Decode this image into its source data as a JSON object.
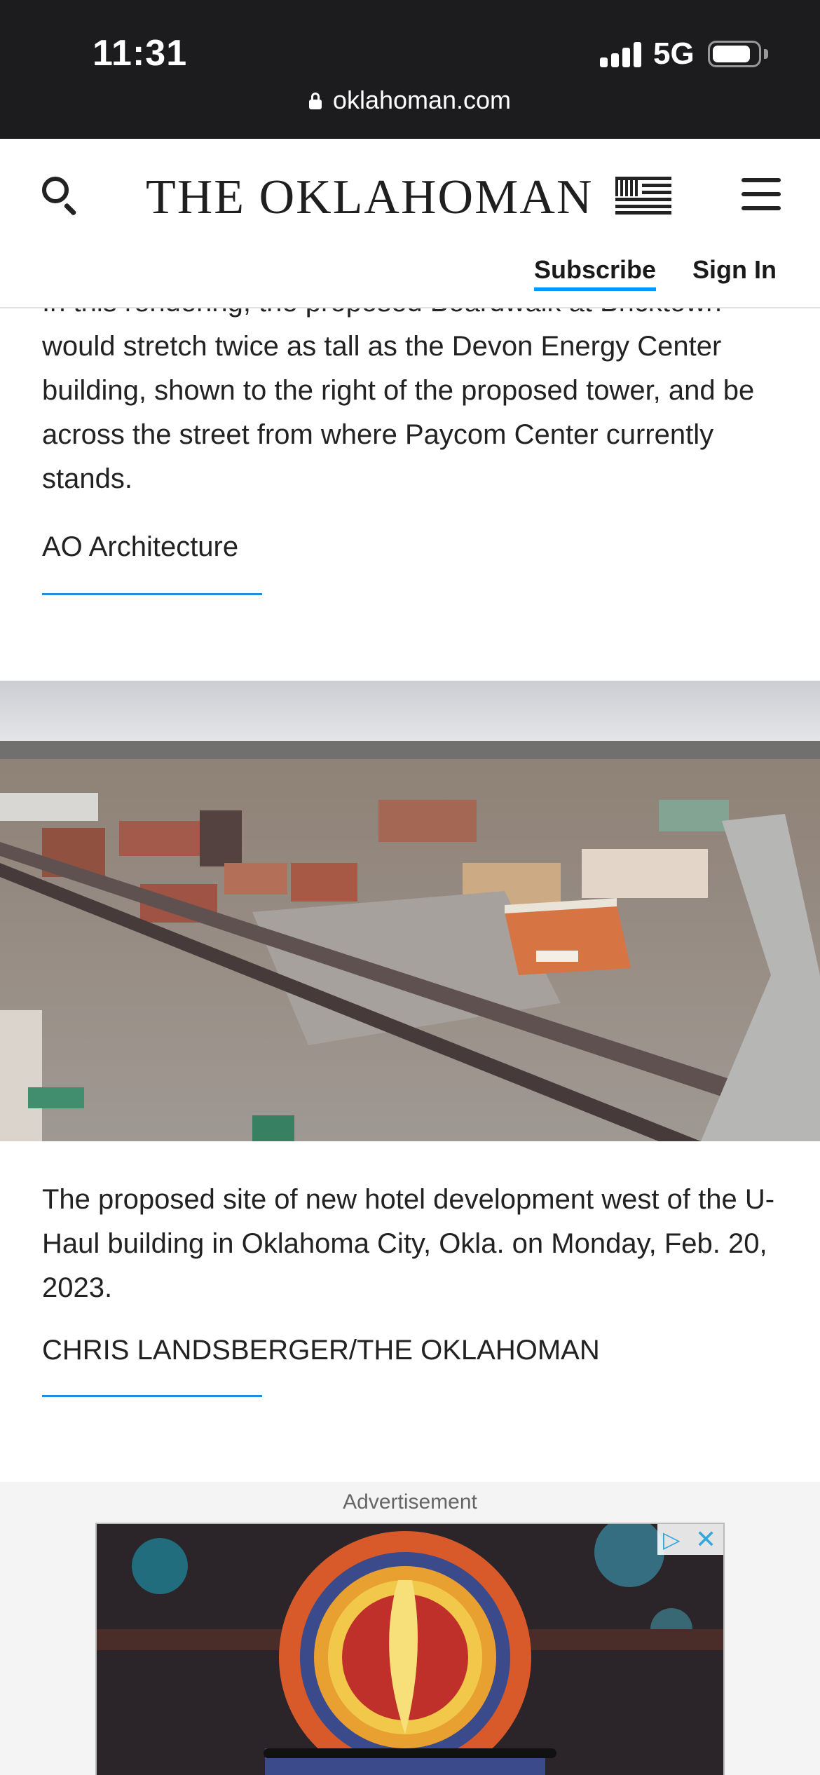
{
  "status_bar": {
    "time": "11:31",
    "network": "5G",
    "signal_bars": 4,
    "battery_level": 0.85,
    "url": "oklahoman.com"
  },
  "header": {
    "masthead": "THE OKLAHOMAN",
    "subscribe_label": "Subscribe",
    "signin_label": "Sign In",
    "accent_color": "#009bff"
  },
  "article": {
    "caption_1": "In this rendering, the proposed Boardwalk at Bricktown would stretch twice as tall as the Devon Energy Center building, shown to the right of the proposed tower, and be across the street from where Paycom Center currently stands.",
    "credit_1": "AO Architecture",
    "caption_2": "The proposed site of new hotel development west of the U-Haul building in Oklahoma City, Okla. on Monday, Feb. 20, 2023.",
    "credit_2": "CHRIS LANDSBERGER/THE OKLAHOMAN"
  },
  "ad": {
    "label": "Advertisement"
  },
  "icons": {
    "search": "search-icon",
    "menu": "hamburger-menu-icon",
    "flag": "flag-icon",
    "lock": "lock-icon",
    "ad_choices": "ad-choices-icon",
    "close": "close-icon"
  }
}
